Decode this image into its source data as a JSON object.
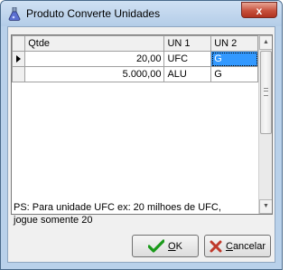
{
  "window": {
    "title": "Produto Converte Unidades",
    "close_label": "x"
  },
  "grid": {
    "columns": [
      "Qtde",
      "UN 1",
      "UN 2"
    ],
    "rows": [
      {
        "qtde": "20,00",
        "un1": "UFC",
        "un2": "G"
      },
      {
        "qtde": "5.000,00",
        "un1": "ALU",
        "un2": "G"
      }
    ]
  },
  "note": {
    "line1": "PS: Para unidade UFC ex: 20 milhoes de UFC,",
    "line2": "jogue somente 20"
  },
  "buttons": {
    "ok_first": "O",
    "ok_rest": "K",
    "cancel_first": "C",
    "cancel_rest": "ancelar"
  },
  "colors": {
    "ok_check": "#1a9a1a",
    "cancel_x": "#c0392b",
    "selection": "#3399ff"
  }
}
